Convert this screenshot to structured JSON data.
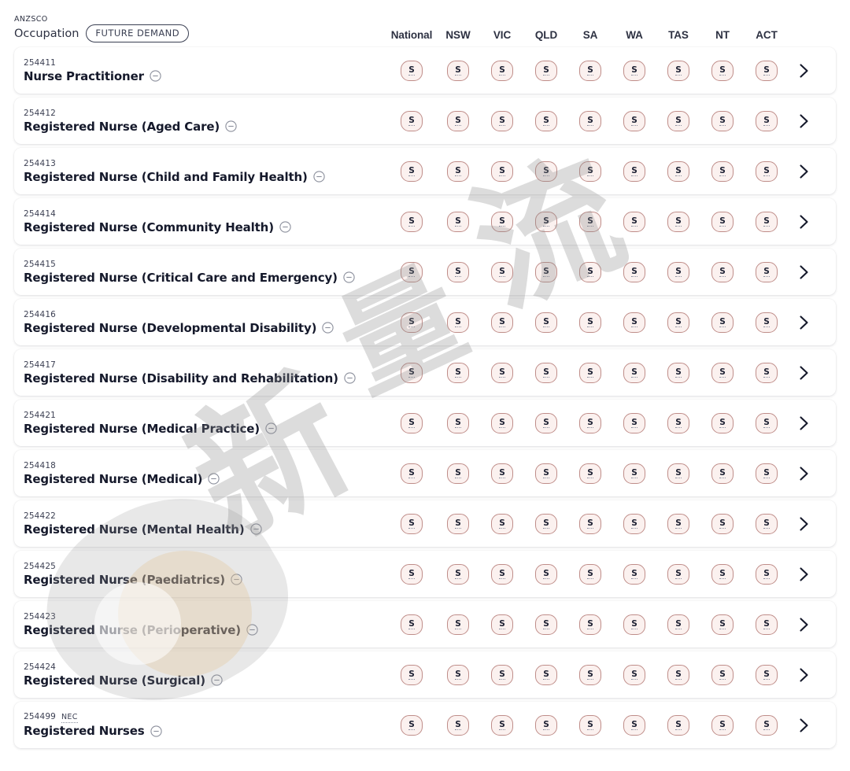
{
  "header": {
    "anzsco_label": "ANZSCO",
    "occupation_label": "Occupation",
    "future_demand_pill": "FUTURE DEMAND",
    "columns": [
      "National",
      "NSW",
      "VIC",
      "QLD",
      "SA",
      "WA",
      "TAS",
      "NT",
      "ACT"
    ]
  },
  "icons": {
    "minus": "minus-circle-icon",
    "chevron": "chevron-right-icon"
  },
  "colors": {
    "badge_border": "#bf8d89",
    "badge_fill": "#fbf1ef",
    "text_primary": "#15192b",
    "text_secondary": "#3b3f52",
    "card_bg": "#ffffff",
    "page_bg": "#ffffff"
  },
  "watermark": {
    "glyphs": [
      "新",
      "流",
      "量"
    ]
  },
  "rows": [
    {
      "code": "254411",
      "nec": "",
      "title": "Nurse Practitioner",
      "ratings": [
        "S",
        "S",
        "S",
        "S",
        "S",
        "S",
        "S",
        "S",
        "S"
      ]
    },
    {
      "code": "254412",
      "nec": "",
      "title": "Registered Nurse (Aged Care)",
      "ratings": [
        "S",
        "S",
        "S",
        "S",
        "S",
        "S",
        "S",
        "S",
        "S"
      ]
    },
    {
      "code": "254413",
      "nec": "",
      "title": "Registered Nurse (Child and Family Health)",
      "ratings": [
        "S",
        "S",
        "S",
        "S",
        "S",
        "S",
        "S",
        "S",
        "S"
      ]
    },
    {
      "code": "254414",
      "nec": "",
      "title": "Registered Nurse (Community Health)",
      "ratings": [
        "S",
        "S",
        "S",
        "S",
        "S",
        "S",
        "S",
        "S",
        "S"
      ]
    },
    {
      "code": "254415",
      "nec": "",
      "title": "Registered Nurse (Critical Care and Emergency)",
      "ratings": [
        "S",
        "S",
        "S",
        "S",
        "S",
        "S",
        "S",
        "S",
        "S"
      ]
    },
    {
      "code": "254416",
      "nec": "",
      "title": "Registered Nurse (Developmental Disability)",
      "ratings": [
        "S",
        "S",
        "S",
        "S",
        "S",
        "S",
        "S",
        "S",
        "S"
      ]
    },
    {
      "code": "254417",
      "nec": "",
      "title": "Registered Nurse (Disability and Rehabilitation)",
      "ratings": [
        "S",
        "S",
        "S",
        "S",
        "S",
        "S",
        "S",
        "S",
        "S"
      ]
    },
    {
      "code": "254421",
      "nec": "",
      "title": "Registered Nurse (Medical Practice)",
      "ratings": [
        "S",
        "S",
        "S",
        "S",
        "S",
        "S",
        "S",
        "S",
        "S"
      ]
    },
    {
      "code": "254418",
      "nec": "",
      "title": "Registered Nurse (Medical)",
      "ratings": [
        "S",
        "S",
        "S",
        "S",
        "S",
        "S",
        "S",
        "S",
        "S"
      ]
    },
    {
      "code": "254422",
      "nec": "",
      "title": "Registered Nurse (Mental Health)",
      "ratings": [
        "S",
        "S",
        "S",
        "S",
        "S",
        "S",
        "S",
        "S",
        "S"
      ]
    },
    {
      "code": "254425",
      "nec": "",
      "title": "Registered Nurse (Paediatrics)",
      "ratings": [
        "S",
        "S",
        "S",
        "S",
        "S",
        "S",
        "S",
        "S",
        "S"
      ]
    },
    {
      "code": "254423",
      "nec": "",
      "title": "Registered Nurse (Perioperative)",
      "ratings": [
        "S",
        "S",
        "S",
        "S",
        "S",
        "S",
        "S",
        "S",
        "S"
      ]
    },
    {
      "code": "254424",
      "nec": "",
      "title": "Registered Nurse (Surgical)",
      "ratings": [
        "S",
        "S",
        "S",
        "S",
        "S",
        "S",
        "S",
        "S",
        "S"
      ]
    },
    {
      "code": "254499",
      "nec": "NEC",
      "title": "Registered Nurses",
      "ratings": [
        "S",
        "S",
        "S",
        "S",
        "S",
        "S",
        "S",
        "S",
        "S"
      ]
    }
  ]
}
